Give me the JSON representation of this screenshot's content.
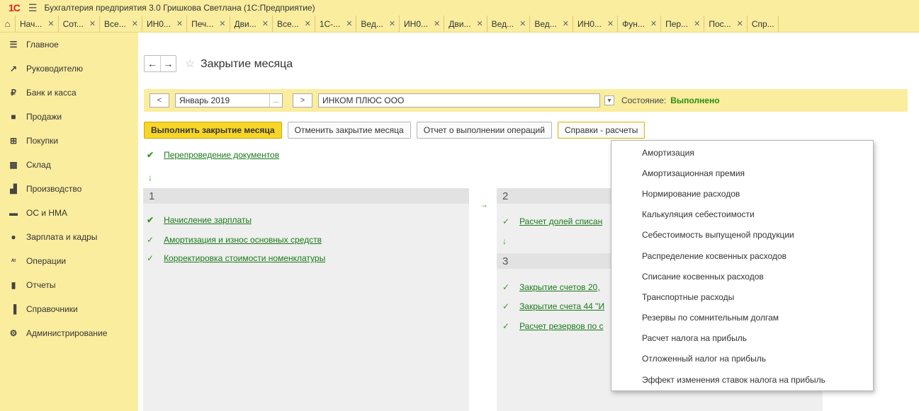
{
  "app": {
    "logo": "1С",
    "title": "Бухгалтерия предприятия 3.0 Гришкова Светлана  (1С:Предприятие)"
  },
  "tabs": [
    "Нач...",
    "Сот...",
    "Все...",
    "ИН0...",
    "Печ...",
    "Дви...",
    "Все...",
    "1С-...",
    "Вед...",
    "ИН0...",
    "Дви...",
    "Вед...",
    "Вед...",
    "ИН0...",
    "Фун...",
    "Пер...",
    "Пос...",
    "Спр..."
  ],
  "sidebar": {
    "items": [
      {
        "label": "Главное",
        "icon": "menu-icon"
      },
      {
        "label": "Руководителю",
        "icon": "chart-trend-icon"
      },
      {
        "label": "Банк и касса",
        "icon": "ruble-icon"
      },
      {
        "label": "Продажи",
        "icon": "bag-icon"
      },
      {
        "label": "Покупки",
        "icon": "cart-icon"
      },
      {
        "label": "Склад",
        "icon": "warehouse-icon"
      },
      {
        "label": "Производство",
        "icon": "factory-icon"
      },
      {
        "label": "ОС и НМА",
        "icon": "truck-icon"
      },
      {
        "label": "Зарплата и кадры",
        "icon": "person-icon"
      },
      {
        "label": "Операции",
        "icon": "operations-icon"
      },
      {
        "label": "Отчеты",
        "icon": "bar-chart-icon"
      },
      {
        "label": "Справочники",
        "icon": "book-icon"
      },
      {
        "label": "Администрирование",
        "icon": "gear-icon"
      }
    ]
  },
  "form": {
    "title": "Закрытие месяца",
    "period": "Январь 2019",
    "period_dots": "...",
    "prev": "<",
    "next": ">",
    "organization": "ИНКОМ ПЛЮС ООО",
    "state_label": "Состояние:",
    "state_value": "Выполнено",
    "state_color": "#2a8a16"
  },
  "actions": {
    "run": "Выполнить закрытие месяца",
    "cancel": "Отменить закрытие месяца",
    "report": "Отчет о выполнении операций",
    "refs": "Справки - расчеты"
  },
  "steps": {
    "repost": "Перепроведение документов",
    "panel1": {
      "num": "1",
      "items": [
        "Начисление зарплаты",
        "Амортизация и износ основных средств",
        "Корректировка стоимости номенклатуры"
      ]
    },
    "panel2": {
      "num": "2",
      "items": [
        "Расчет долей списан"
      ]
    },
    "panel3": {
      "num": "3",
      "items": [
        "Закрытие счетов 20,",
        "Закрытие счета 44 \"И",
        "Расчет резервов по с"
      ]
    }
  },
  "dropdown": {
    "items": [
      "Амортизация",
      "Амортизационная премия",
      "Нормирование расходов",
      "Калькуляция себестоимости",
      "Себестоимость выпущеной продукции",
      "Распределение косвенных расходов",
      "Списание косвенных расходов",
      "Транспортные расходы",
      "Резервы по сомнительным долгам",
      "Расчет налога на прибыль",
      "Отложенный налог на прибыль",
      "Эффект изменения ставок налога на прибыль"
    ]
  }
}
